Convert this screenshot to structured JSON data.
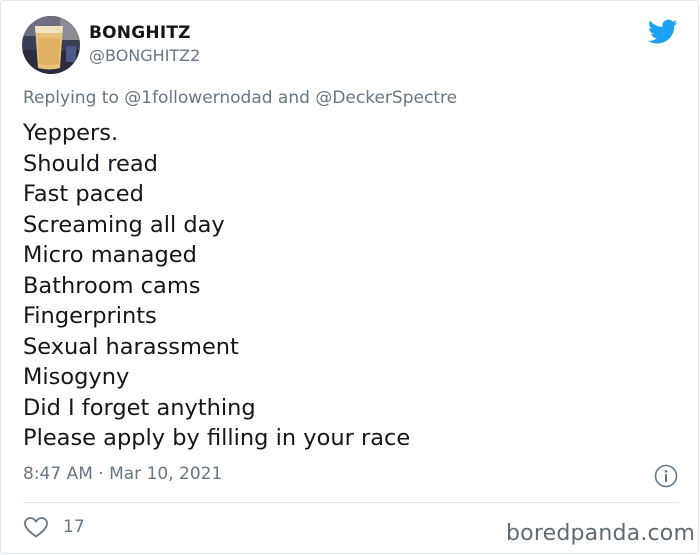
{
  "author": {
    "display_name": "BONGHITZ",
    "handle": "@BONGHITZ2",
    "avatar_icon": "avatar-photo"
  },
  "reply": {
    "prefix": "Replying to ",
    "mention_1": "@1followernodad",
    "joiner": " and ",
    "mention_2": "@DeckerSpectre"
  },
  "tweet_lines": [
    "Yeppers.",
    "Should read",
    "Fast paced",
    "Screaming all day",
    "Micro managed",
    "Bathroom cams",
    "Fingerprints",
    "Sexual harassment",
    "Misogyny",
    "Did I forget anything",
    "Please apply by filling in your race"
  ],
  "meta": {
    "timestamp": "8:47 AM · Mar 10, 2021"
  },
  "actions": {
    "like_count": "17",
    "like_icon": "heart-icon",
    "info_icon": "info-icon"
  },
  "brand": {
    "twitter_icon": "twitter-bird-icon",
    "twitter_color": "#1da1f2",
    "watermark": "boredpanda.com"
  },
  "colors": {
    "text": "#14171a",
    "secondary": "#657786",
    "divider": "#e1e8ed"
  }
}
